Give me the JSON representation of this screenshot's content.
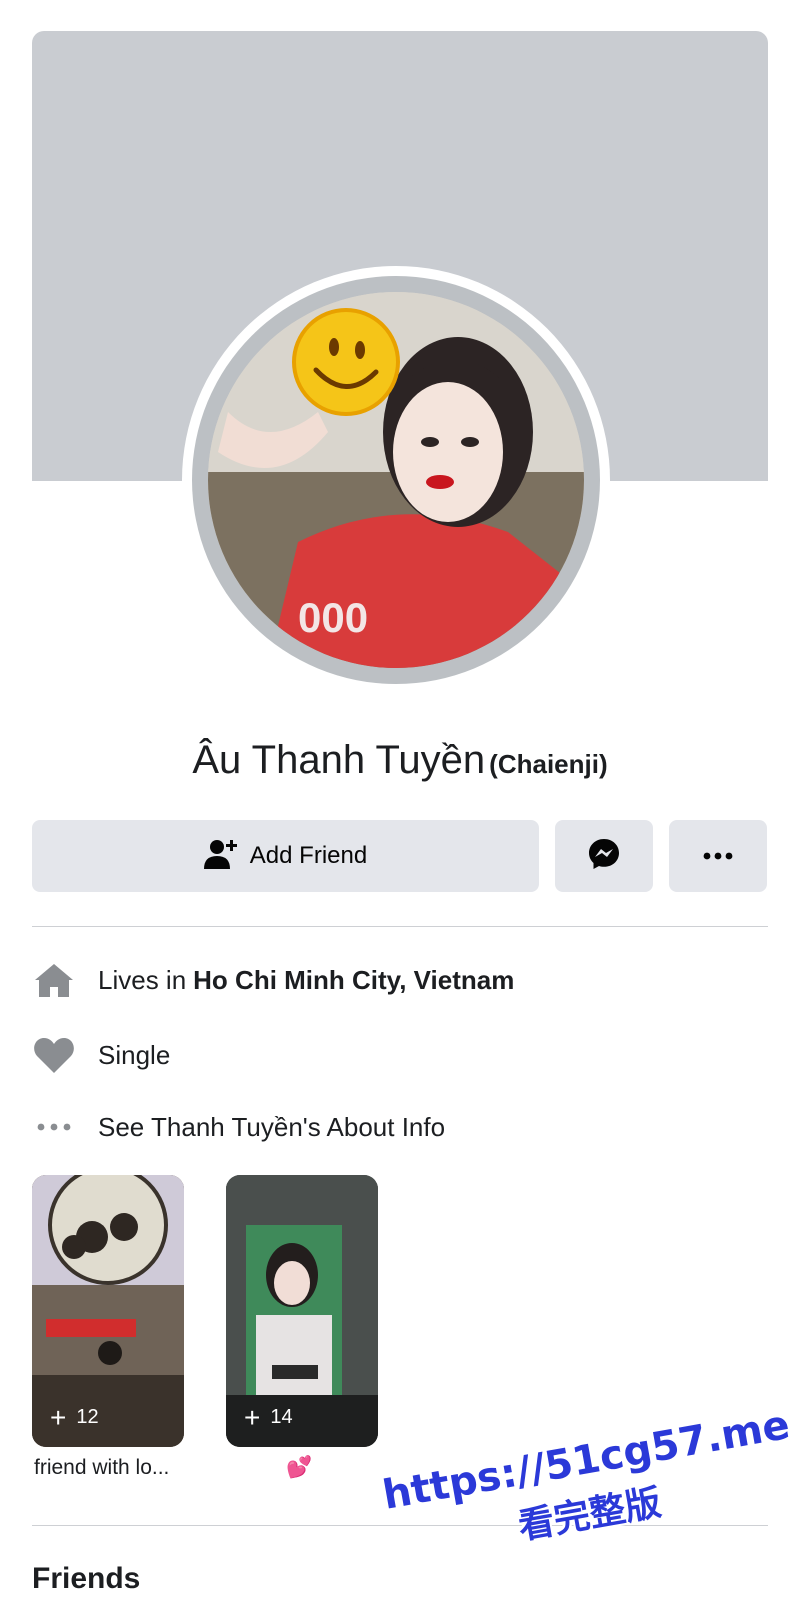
{
  "profile": {
    "name": "Âu Thanh Tuyền",
    "alternate_name": "(Chaienji)"
  },
  "actions": {
    "add_friend_label": "Add Friend",
    "messenger_icon": "messenger-icon",
    "more_icon": "more-dots-icon"
  },
  "intro": {
    "lives_prefix": "Lives in",
    "lives_location": "Ho Chi Minh City, Vietnam",
    "relationship": "Single",
    "about_link": "See Thanh Tuyền's About Info"
  },
  "highlights": [
    {
      "count": "12",
      "title": "friend with lo..."
    },
    {
      "count": "14",
      "title": "💕"
    }
  ],
  "sections": {
    "friends_title": "Friends"
  },
  "watermark": {
    "line1": "https://51cg57.me",
    "line2": "看完整版"
  },
  "colors": {
    "cover": "#c9ccd1",
    "button_bg": "#e4e6eb",
    "icon_gray": "#606770",
    "watermark": "#2b39d8"
  }
}
